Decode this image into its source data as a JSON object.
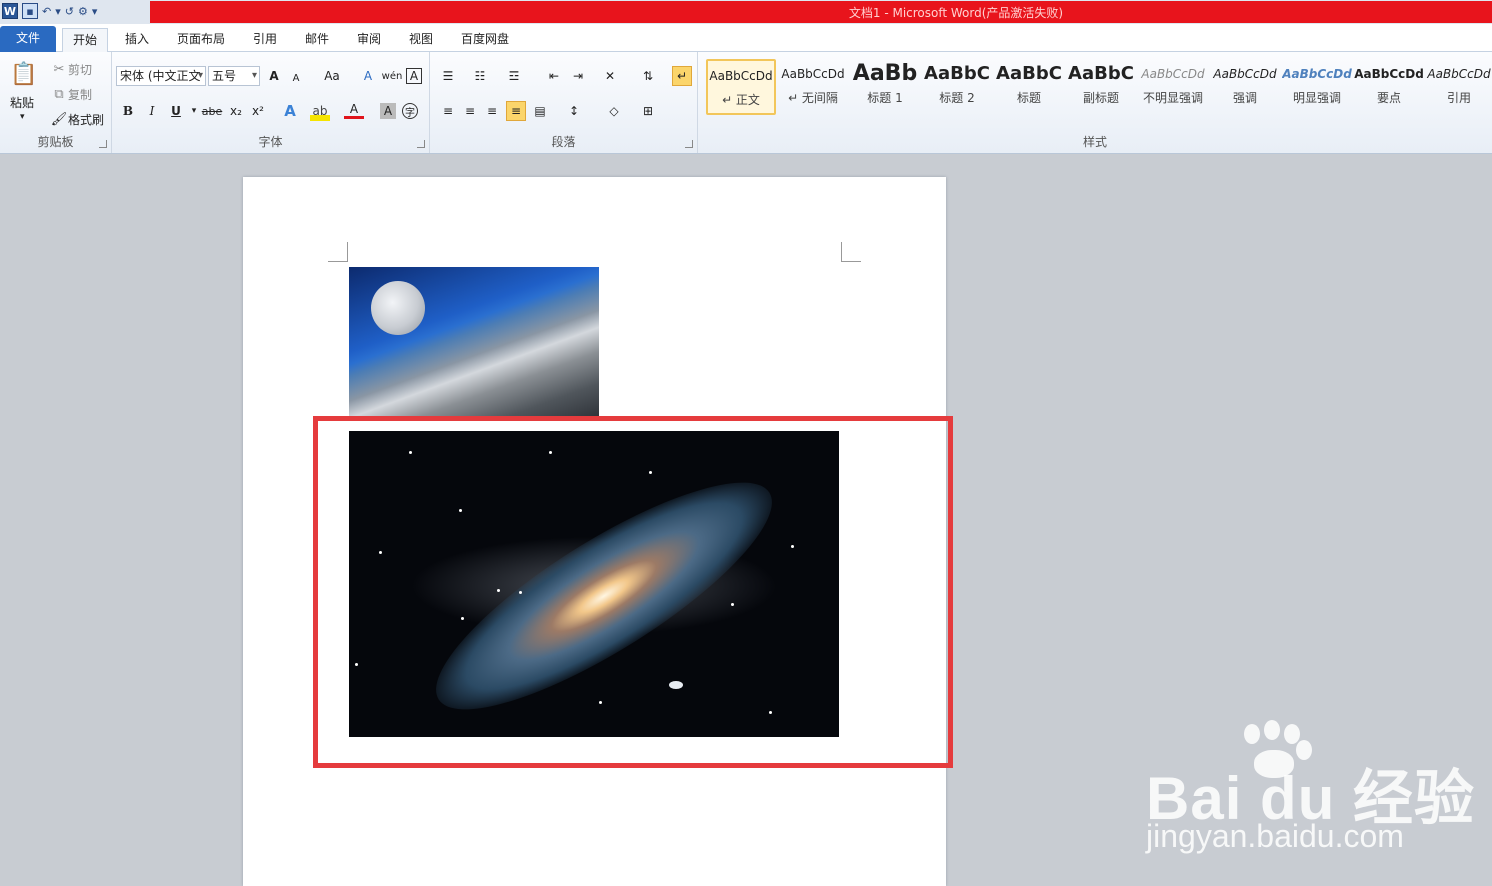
{
  "window": {
    "title": "文档1 - Microsoft Word(产品激活失败)"
  },
  "qat": {
    "word_icon": "W",
    "undo": "↶",
    "redo": "↺"
  },
  "tabs": [
    {
      "label": "文件"
    },
    {
      "label": "开始"
    },
    {
      "label": "插入"
    },
    {
      "label": "页面布局"
    },
    {
      "label": "引用"
    },
    {
      "label": "邮件"
    },
    {
      "label": "审阅"
    },
    {
      "label": "视图"
    },
    {
      "label": "百度网盘"
    }
  ],
  "clipboard": {
    "paste": "粘贴",
    "cut": "剪切",
    "copy": "复制",
    "format_painter": "格式刷",
    "group_label": "剪贴板"
  },
  "font": {
    "name": "宋体 (中文正文",
    "size": "五号",
    "group_label": "字体",
    "bold": "B",
    "italic": "I",
    "underline": "U",
    "strike": "abe",
    "sub": "x₂",
    "sup": "x²",
    "grow": "A",
    "shrink": "A",
    "case": "Aa",
    "clear": "A",
    "pinyin": "wén",
    "border_char": "A",
    "enclose": "字"
  },
  "paragraph": {
    "group_label": "段落"
  },
  "styles": {
    "group_label": "样式",
    "items": [
      {
        "sample": "AaBbCcDd",
        "name": "↵ 正文"
      },
      {
        "sample": "AaBbCcDd",
        "name": "↵ 无间隔"
      },
      {
        "sample": "AaBb",
        "name": "标题 1"
      },
      {
        "sample": "AaBbC",
        "name": "标题 2"
      },
      {
        "sample": "AaBbC",
        "name": "标题"
      },
      {
        "sample": "AaBbC",
        "name": "副标题"
      },
      {
        "sample": "AaBbCcDd",
        "name": "不明显强调"
      },
      {
        "sample": "AaBbCcDd",
        "name": "强调"
      },
      {
        "sample": "AaBbCcDd",
        "name": "明显强调"
      },
      {
        "sample": "AaBbCcDd",
        "name": "要点"
      },
      {
        "sample": "AaBbCcDd",
        "name": "引用"
      }
    ]
  },
  "watermark": {
    "brand": "Bai  du 经验",
    "url": "jingyan.baidu.com"
  },
  "colors": {
    "accent": "#2a6ac1",
    "title_red": "#e8141c",
    "highlight": "#e53b3d"
  }
}
